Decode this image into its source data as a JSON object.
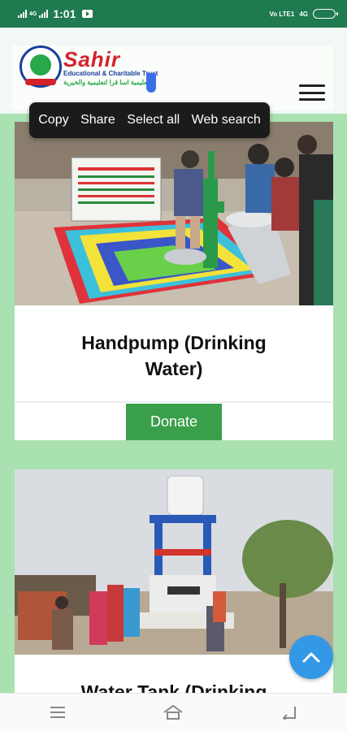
{
  "status_bar": {
    "network_left": "4G",
    "time": "1:01",
    "network_right": "4G",
    "volte": "Vo LTE1"
  },
  "header": {
    "brand_name": "Sahir",
    "tagline": "Educational & Charitable Trust",
    "arabic_tagline": "تعليمية اسا قرا لتعليمية والخيرية",
    "menu_icon": "hamburger-icon"
  },
  "context_menu": {
    "items": [
      "Copy",
      "Share",
      "Select all",
      "Web search"
    ]
  },
  "cards": [
    {
      "title": "Handpump (Drinking Water)",
      "button_label": "Donate"
    },
    {
      "title": "Water Tank (Drinking"
    }
  ],
  "fab": {
    "icon": "chevron-up-icon"
  },
  "nav_bar": {
    "icons": [
      "menu-lines-icon",
      "home-icon",
      "back-icon"
    ]
  },
  "colors": {
    "status_bar": "#1f7a4f",
    "page_background": "#a9e1b0",
    "donate_button": "#3a9f4a",
    "fab": "#3399e6",
    "brand_red": "#d4222b",
    "brand_blue": "#1a3f9a"
  }
}
